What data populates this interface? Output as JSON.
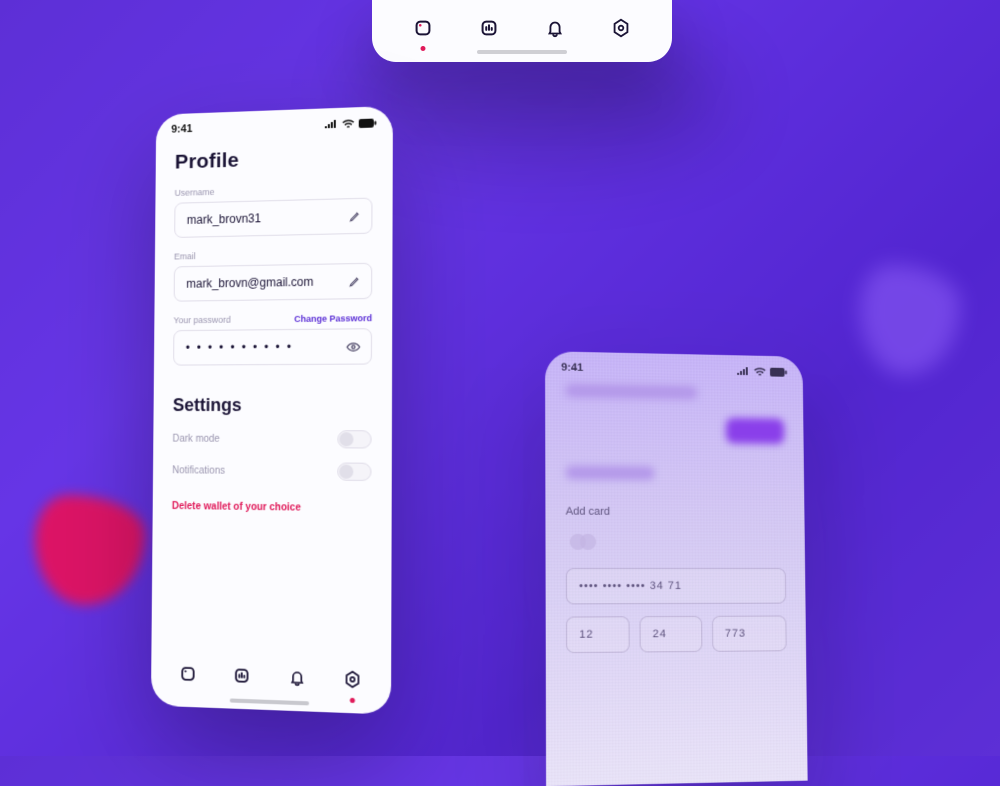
{
  "status_time": "9:41",
  "profile": {
    "heading": "Profile",
    "username_label": "Username",
    "username_value": "mark_brovn31",
    "email_label": "Email",
    "email_value": "mark_brovn@gmail.com",
    "password_label": "Your password",
    "change_password": "Change Password",
    "password_masked": "• • • • • • • • • •"
  },
  "settings": {
    "heading": "Settings",
    "dark_mode": "Dark mode",
    "notifications": "Notifications",
    "danger": "Delete wallet of your choice"
  },
  "addcard": {
    "label": "Add card",
    "number": "••••   ••••   ••••   34 71",
    "mm": "12",
    "yy": "24",
    "cvv": "773"
  },
  "nav": {
    "home": "home-icon",
    "stats": "stats-icon",
    "alerts": "bell-icon",
    "settings": "gear-icon"
  }
}
